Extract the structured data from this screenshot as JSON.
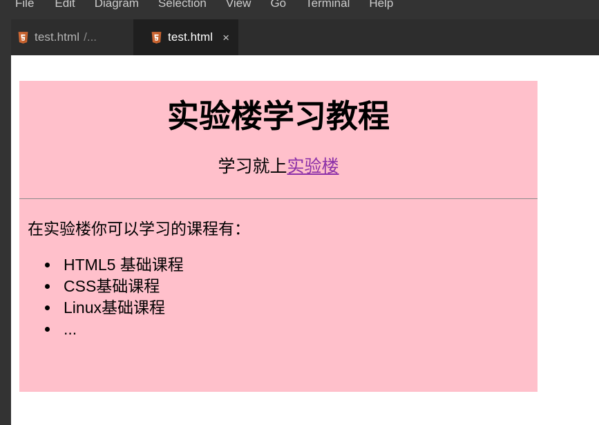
{
  "menubar": {
    "items": [
      {
        "label": "File"
      },
      {
        "label": "Edit"
      },
      {
        "label": "Diagram"
      },
      {
        "label": "Selection"
      },
      {
        "label": "View"
      },
      {
        "label": "Go"
      },
      {
        "label": "Terminal"
      },
      {
        "label": "Help"
      }
    ]
  },
  "tabs": [
    {
      "label": "test.html",
      "path_suffix": "/...",
      "icon": "html5-file-icon",
      "active": false,
      "closable": false
    },
    {
      "label": "test.html",
      "path_suffix": "",
      "icon": "html5-file-icon",
      "active": true,
      "closable": true,
      "close_label": "×"
    }
  ],
  "preview": {
    "title": "实验楼学习教程",
    "subtitle_prefix": "学习就上",
    "subtitle_link": "实验楼",
    "paragraph": "在实验楼你可以学习的课程有：",
    "list": [
      "HTML5 基础课程",
      "CSS基础课程",
      "Linux基础课程",
      "..."
    ]
  },
  "colors": {
    "menubar_bg": "#333333",
    "tabbar_bg": "#252526",
    "tab_inactive_bg": "#2d2d2d",
    "tab_active_bg": "#1f1f1f",
    "page_bg": "#ffffff",
    "body_bg": "#ffc0cb",
    "link": "#8b2fa8",
    "html5_icon": "#cc6633",
    "hr": "#8a8a8a"
  }
}
